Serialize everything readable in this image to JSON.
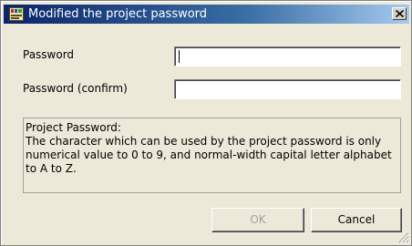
{
  "window": {
    "title": "Modified the project password",
    "icon": "app-window-icon",
    "close_icon": "close-icon"
  },
  "form": {
    "password_label": "Password",
    "password_value": "",
    "confirm_label": "Password (confirm)",
    "confirm_value": ""
  },
  "info": {
    "lines": [
      "Project Password:",
      "The character which can be used by the project password is only",
      "numerical value to 0 to 9, and normal-width capital letter alphabet",
      "to A to Z."
    ]
  },
  "buttons": {
    "ok_label": "OK",
    "ok_enabled": false,
    "cancel_label": "Cancel"
  },
  "colors": {
    "dialog_background": "#ece9d8",
    "titlebar_start": "#0a246a",
    "titlebar_end": "#a6caf0",
    "disabled_text": "#a0a0a0"
  }
}
